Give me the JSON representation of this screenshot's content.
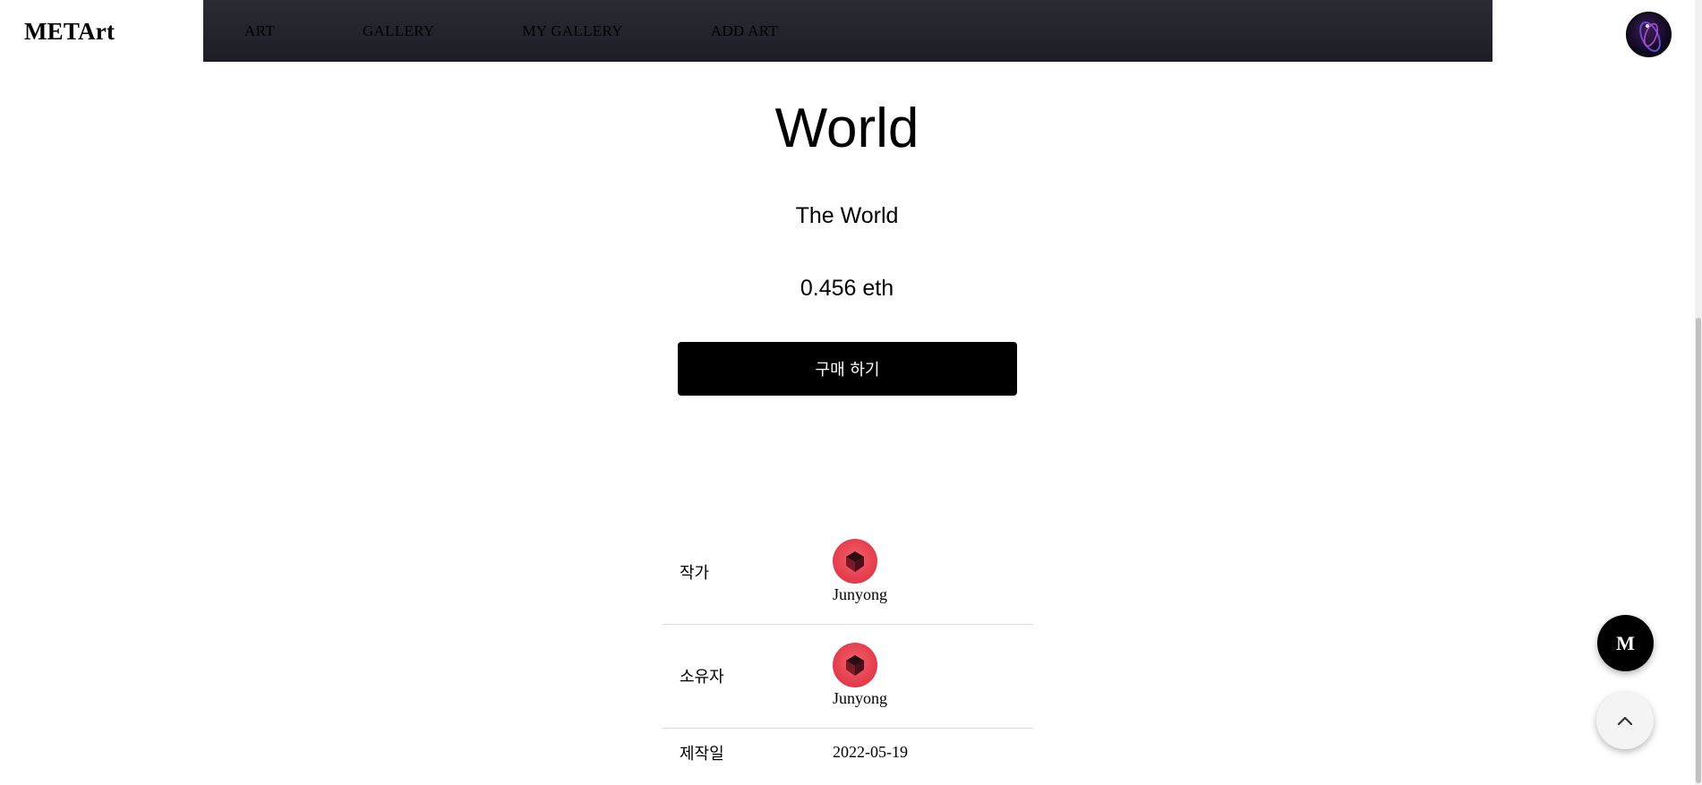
{
  "header": {
    "logo": "METArt",
    "nav": [
      "ART",
      "GALLERY",
      "MY GALLERY",
      "ADD ART"
    ],
    "nav_bg": "#1c1d26"
  },
  "artwork": {
    "title": "World",
    "description": "The World",
    "price": "0.456 eth",
    "buy_label": "구매 하기"
  },
  "info": {
    "artist_label": "작가",
    "artist_name": "Junyong",
    "owner_label": "소유자",
    "owner_name": "Junyong",
    "created_label": "제작일",
    "created_value": "2022-05-19"
  },
  "floating": {
    "m_label": "M",
    "top_icon": "chevron-up-icon"
  },
  "colors": {
    "avatar_red": "#e23a4a",
    "button_bg": "#000000"
  }
}
